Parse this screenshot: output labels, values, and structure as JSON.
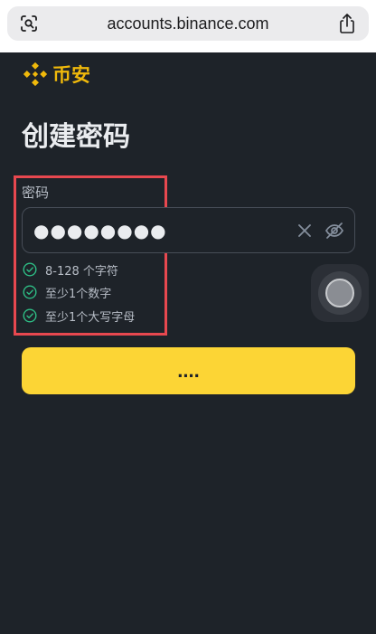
{
  "browser": {
    "url": "accounts.binance.com"
  },
  "logo": {
    "text": "币安",
    "color": "#f0b90b"
  },
  "page": {
    "title": "创建密码"
  },
  "password_field": {
    "label": "密码",
    "masked_value": "●●●●●●●●"
  },
  "rules": [
    {
      "text": "8-128 个字符",
      "status": "passed"
    },
    {
      "text": "至少1个数字",
      "status": "passed"
    },
    {
      "text": "至少1个大写字母",
      "status": "passed"
    }
  ],
  "submit": {
    "label": "....",
    "color": "#fcd535"
  },
  "icons": {
    "browser_left": "visual-lookup-icon",
    "browser_right": "share-icon",
    "clear": "clear-icon",
    "visibility": "eye-slash-icon",
    "rule_check": "check-circle-icon"
  }
}
